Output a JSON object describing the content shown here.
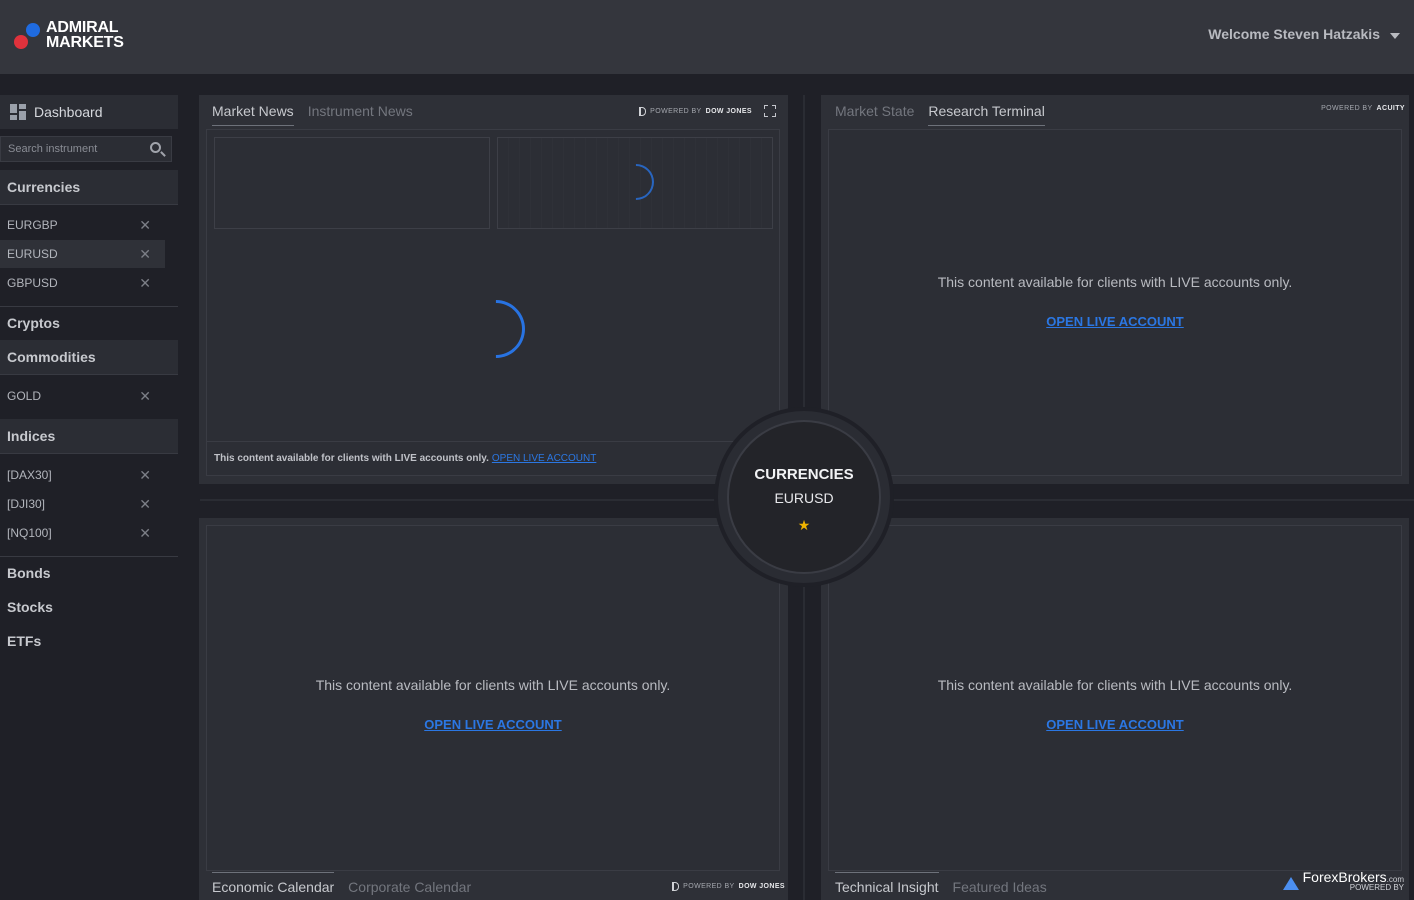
{
  "header": {
    "logo_line1": "ADMIRAL",
    "logo_line2": "MARKETS",
    "welcome": "Welcome Steven Hatzakis"
  },
  "sidebar": {
    "dashboard_label": "Dashboard",
    "search_placeholder": "Search instrument",
    "categories": {
      "currencies": "Currencies",
      "cryptos": "Cryptos",
      "commodities": "Commodities",
      "indices": "Indices",
      "bonds": "Bonds",
      "stocks": "Stocks",
      "etfs": "ETFs"
    },
    "currencies": [
      "EURGBP",
      "EURUSD",
      "GBPUSD"
    ],
    "selected_currency": "EURUSD",
    "commodities": [
      "GOLD"
    ],
    "indices": [
      "[DAX30]",
      "[DJI30]",
      "[NQ100]"
    ],
    "remove_glyph": "✕"
  },
  "panels": {
    "top_left": {
      "tabs": [
        "Market News",
        "Instrument News"
      ],
      "active_tab": "Market News",
      "powered_prefix": "POWERED BY",
      "powered_brand": "DOW JONES",
      "notice": "This content available for clients with LIVE accounts only.",
      "link": "OPEN LIVE ACCOUNT"
    },
    "top_right": {
      "tabs": [
        "Market State",
        "Research Terminal"
      ],
      "active_tab": "Research Terminal",
      "powered_prefix": "POWERED BY",
      "powered_brand": "ACUITY",
      "notice": "This content available for clients with LIVE accounts only.",
      "link": "OPEN LIVE ACCOUNT"
    },
    "bottom_left": {
      "tabs": [
        "Economic Calendar",
        "Corporate Calendar"
      ],
      "active_tab": "Economic Calendar",
      "powered_prefix": "POWERED BY",
      "powered_brand": "DOW JONES",
      "notice": "This content available for clients with LIVE accounts only.",
      "link": "OPEN LIVE ACCOUNT"
    },
    "bottom_right": {
      "tabs": [
        "Technical Insight",
        "Featured Ideas"
      ],
      "active_tab": "Technical Insight",
      "notice": "This content available for clients with LIVE accounts only.",
      "link": "OPEN LIVE ACCOUNT"
    }
  },
  "center": {
    "category": "CURRENCIES",
    "instrument": "EURUSD",
    "favorite_glyph": "★"
  },
  "watermark": {
    "brand": "ForexBrokers",
    "suffix": ".com",
    "sub": "POWERED BY"
  },
  "colors": {
    "accent": "#2b77e3",
    "star": "#f0b400",
    "logo_blue": "#1f6be0",
    "logo_red": "#e0323c"
  }
}
